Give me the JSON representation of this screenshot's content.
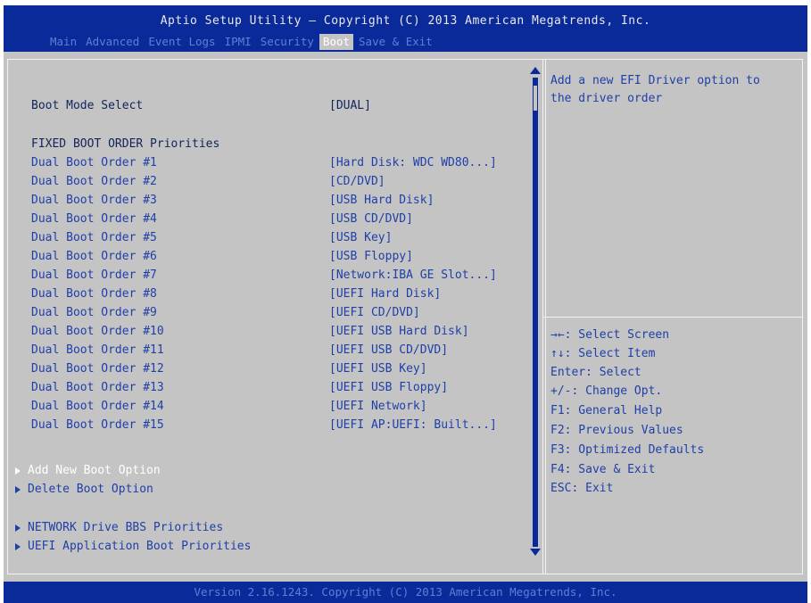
{
  "app_title": "Aptio Setup Utility – Copyright (C) 2013 American Megatrends, Inc.",
  "menu_tabs": [
    {
      "label": "Main",
      "active": false
    },
    {
      "label": "Advanced",
      "active": false
    },
    {
      "label": "Event Logs",
      "active": false
    },
    {
      "label": "IPMI",
      "active": false
    },
    {
      "label": "Security",
      "active": false
    },
    {
      "label": "Boot",
      "active": true
    },
    {
      "label": "Save & Exit",
      "active": false
    }
  ],
  "boot_mode": {
    "label": "Boot Mode Select",
    "value": "[DUAL]"
  },
  "fixed_heading": "FIXED BOOT ORDER Priorities",
  "boot_orders": [
    {
      "label": "Dual Boot Order #1",
      "value": "[Hard Disk: WDC WD80...]"
    },
    {
      "label": "Dual Boot Order #2",
      "value": "[CD/DVD]"
    },
    {
      "label": "Dual Boot Order #3",
      "value": "[USB Hard Disk]"
    },
    {
      "label": "Dual Boot Order #4",
      "value": "[USB CD/DVD]"
    },
    {
      "label": "Dual Boot Order #5",
      "value": "[USB Key]"
    },
    {
      "label": "Dual Boot Order #6",
      "value": "[USB Floppy]"
    },
    {
      "label": "Dual Boot Order #7",
      "value": "[Network:IBA GE Slot...]"
    },
    {
      "label": "Dual Boot Order #8",
      "value": "[UEFI Hard Disk]"
    },
    {
      "label": "Dual Boot Order #9",
      "value": "[UEFI CD/DVD]"
    },
    {
      "label": "Dual Boot Order #10",
      "value": "[UEFI USB Hard Disk]"
    },
    {
      "label": "Dual Boot Order #11",
      "value": "[UEFI USB CD/DVD]"
    },
    {
      "label": "Dual Boot Order #12",
      "value": "[UEFI USB Key]"
    },
    {
      "label": "Dual Boot Order #13",
      "value": "[UEFI USB Floppy]"
    },
    {
      "label": "Dual Boot Order #14",
      "value": "[UEFI Network]"
    },
    {
      "label": "Dual Boot Order #15",
      "value": "[UEFI AP:UEFI: Built...]"
    }
  ],
  "submenus": [
    {
      "label": "Add New Boot Option",
      "selected": true
    },
    {
      "label": "Delete Boot Option",
      "selected": false
    },
    {
      "label": "NETWORK Drive BBS Priorities",
      "selected": false
    },
    {
      "label": "UEFI Application Boot Priorities",
      "selected": false
    }
  ],
  "help_text": [
    "Add a new EFI Driver option to",
    "the driver order"
  ],
  "key_help": [
    "→←: Select Screen",
    "↑↓: Select Item",
    "Enter: Select",
    "+/-: Change Opt.",
    "F1: General Help",
    "F2: Previous Values",
    "F3: Optimized Defaults",
    "F4: Save & Exit",
    "ESC: Exit"
  ],
  "footer": "Version 2.16.1243. Copyright (C) 2013 American Megatrends, Inc.",
  "colors": {
    "bar_blue": "#0a2a9a",
    "panel_gray": "#c4c4c4",
    "text_blue": "#1f3fa8",
    "selected_white": "#ffffff"
  }
}
